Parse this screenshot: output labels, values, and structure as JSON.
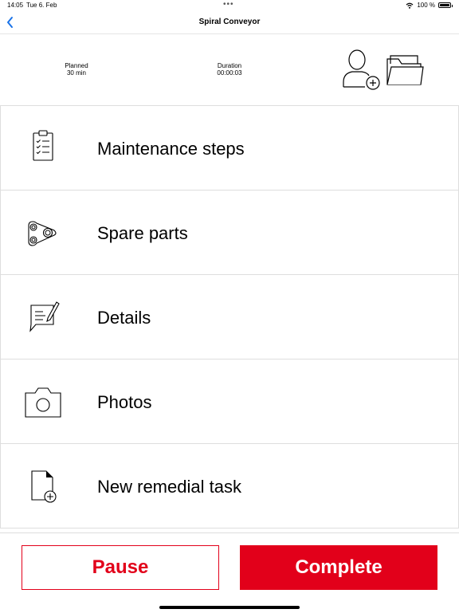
{
  "status_bar": {
    "time": "14:05",
    "date": "Tue 6. Feb",
    "dots": "•••",
    "battery_text": "100 %"
  },
  "nav": {
    "title": "Spiral Conveyor"
  },
  "summary": {
    "planned_label": "Planned",
    "planned_value": "30 min",
    "duration_label": "Duration",
    "duration_value": "00:00:03"
  },
  "menu": {
    "items": [
      {
        "label": "Maintenance steps",
        "icon": "clipboard-checklist-icon"
      },
      {
        "label": "Spare parts",
        "icon": "gears-icon"
      },
      {
        "label": "Details",
        "icon": "note-edit-icon"
      },
      {
        "label": "Photos",
        "icon": "camera-icon"
      },
      {
        "label": "New remedial task",
        "icon": "new-document-icon"
      }
    ]
  },
  "actions": {
    "pause_label": "Pause",
    "complete_label": "Complete"
  },
  "colors": {
    "accent": "#e2001a",
    "link": "#1a73e8"
  }
}
